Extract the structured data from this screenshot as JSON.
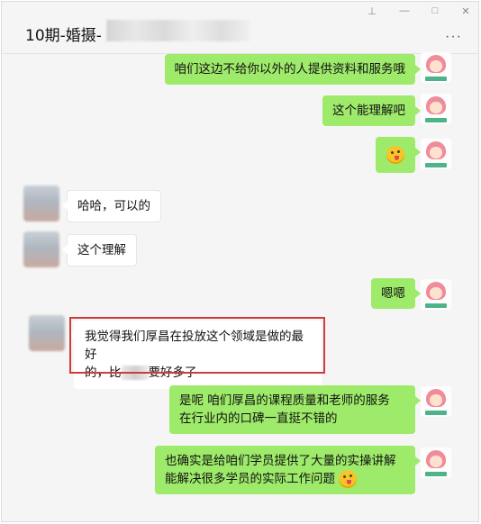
{
  "window": {
    "title": "10期-婚摄-",
    "controls": {
      "pin": "⊥",
      "minimize": "—",
      "maximize": "□",
      "close": "✕"
    },
    "more": "···"
  },
  "messages": [
    {
      "side": "me",
      "text": "咱们这边不给你以外的人提供资料和服务哦"
    },
    {
      "side": "me",
      "text": "这个能理解吧"
    },
    {
      "side": "me",
      "text": "",
      "emoji": "tongue-out-emoji"
    },
    {
      "side": "them",
      "text": "哈哈，可以的"
    },
    {
      "side": "them",
      "text": "这个理解"
    },
    {
      "side": "me",
      "text": "嗯嗯"
    },
    {
      "side": "them",
      "line1": "我觉得我们厚昌在投放这个领域是做的最好",
      "line2a": "的，比",
      "line2b": "要好多了"
    },
    {
      "side": "me",
      "line1": "是呢  咱们厚昌的课程质量和老师的服务",
      "line2": "在行业内的口碑一直挺不错的"
    },
    {
      "side": "me",
      "line1": "也确实是给咱们学员提供了大量的实操讲解",
      "line2": "能解决很多学员的实际工作问题"
    }
  ]
}
